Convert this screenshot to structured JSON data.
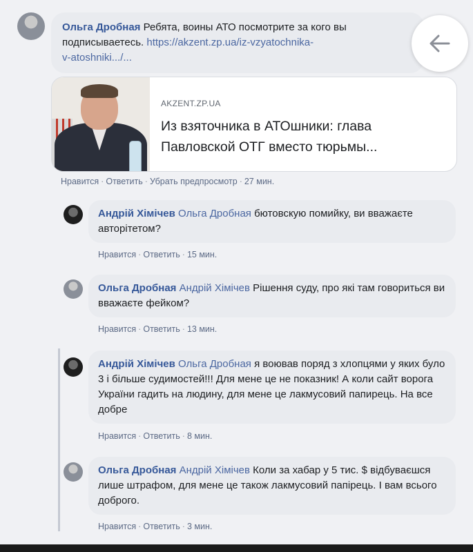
{
  "post": {
    "author": "Ольга Дробная",
    "text": "Ребята, воины АТО посмотрите за кого вы подписываетесь.",
    "link_line1": "https://akzent.zp.ua/iz-vzyatochnika-",
    "link_line2": "v-atoshniki.../...",
    "preview": {
      "site": "AKZENT.ZP.UA",
      "title": "Из взяточника в АТОшники: глава Павловской ОТГ вместо тюрьмы..."
    },
    "actions": {
      "like": "Нравится",
      "reply": "Ответить",
      "remove_preview": "Убрать предпросмотр",
      "time": "27 мин."
    }
  },
  "replies": [
    {
      "author": "Андрій Хімічев",
      "mention": "Ольга Дробная",
      "text": "бютовскую помийку, ви вважаєте авторітетом?",
      "like": "Нравится",
      "reply": "Ответить",
      "time": "15 мин."
    },
    {
      "author": "Ольга Дробная",
      "mention": "Андрій Хімічев",
      "text": "Рішення суду, про які там говориться ви вважаєте фейком?",
      "like": "Нравится",
      "reply": "Ответить",
      "time": "13 мин."
    },
    {
      "author": "Андрій Хімічев",
      "mention": "Ольга Дробная",
      "text": "я воював поряд з хлопцями у яких було 3 і більше судимостей!!! Для мене це не показник! А коли сайт ворога України гадить на людину, для мене це лакмусовий папирець. На все добре",
      "like": "Нравится",
      "reply": "Ответить",
      "time": "8 мин."
    },
    {
      "author": "Ольга Дробная",
      "mention": "Андрій Хімічев",
      "text": "Коли за хабар у 5 тис. $ відбуваєшся лише штрафом, для мене це також лакмусовий папірець. І вам всього доброго.",
      "like": "Нравится",
      "reply": "Ответить",
      "time": "3 мин."
    }
  ],
  "icons": {
    "back": "arrow-left-icon"
  },
  "colors": {
    "author": "#365899",
    "mention": "#4b67a1",
    "bubble": "#e9ebef",
    "background": "#f0f1f4"
  }
}
